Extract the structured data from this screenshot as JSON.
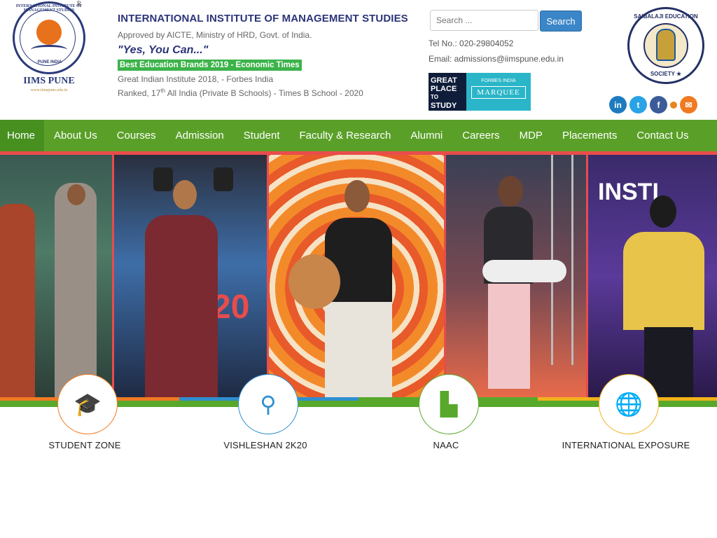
{
  "header": {
    "logo": {
      "ring_text": "INTERNATIONAL INSTITUTE OF MANAGEMENT STUDIES",
      "pune_text": "PUNE   INDIA",
      "name": "IIMS PUNE",
      "website": "www.iimspune.edu.in",
      "registered": "R"
    },
    "institute_name": "INTERNATIONAL INSTITUTE OF MANAGEMENT STUDIES",
    "approved": "Approved by AICTE, Ministry of HRD, Govt. of India.",
    "slogan": "\"Yes, You Can...\"",
    "badge": "Best Education Brands 2019 - Economic Times",
    "award1": "Great Indian Institute 2018, - Forbes India",
    "award2_prefix": "Ranked, 17",
    "award2_sup": "th",
    "award2_suffix": " All India (Private B Schools) - Times B School - 2020"
  },
  "search": {
    "placeholder": "Search ...",
    "button_label": "Search"
  },
  "contact": {
    "tel": "Tel No.: 020-29804052",
    "email": "Email: admissions@iimspune.edu.in"
  },
  "gptw": {
    "line1": "GREAT",
    "line2": "PLACE",
    "line3": "TO",
    "line4": "STUDY",
    "forbes": "FORBES INDIA",
    "marquee": "MARQUEE"
  },
  "seal": {
    "top_text": "SAIBALAJI EDUCATION",
    "bottom_text": "SOCIETY ★"
  },
  "socials": [
    {
      "name": "linkedin-icon",
      "glyph": "in",
      "color": "#1d7bbf"
    },
    {
      "name": "twitter-icon",
      "glyph": "t",
      "color": "#2aa3e6"
    },
    {
      "name": "facebook-icon",
      "glyph": "f",
      "color": "#3b5b99"
    },
    {
      "name": "instagram-icon",
      "glyph": "",
      "color": "#e8851c"
    },
    {
      "name": "email-icon",
      "glyph": "✉",
      "color": "#f07a22"
    }
  ],
  "nav": {
    "items": [
      "Home",
      "About Us",
      "Courses",
      "Admission",
      "Student",
      "Faculty & Research",
      "Alumni",
      "Careers",
      "MDP",
      "Placements",
      "Contact Us"
    ]
  },
  "features": [
    {
      "label": "STUDENT ZONE",
      "icon": "graduate-icon",
      "color": "#f07a22",
      "glyph": "🎓"
    },
    {
      "label": "VISHLESHAN 2K20",
      "icon": "analysis-icon",
      "color": "#2f8fce",
      "glyph": "⚲"
    },
    {
      "label": "NAAC",
      "icon": "factory-icon",
      "color": "#58a82c",
      "glyph": "▙"
    },
    {
      "label": "INTERNATIONAL EXPOSURE",
      "icon": "globe-icon",
      "color": "#f2b21b",
      "glyph": "🌐"
    }
  ],
  "colors": {
    "nav_green": "#5aa028",
    "title_blue": "#2c3479",
    "badge_green": "#3cb34a"
  }
}
